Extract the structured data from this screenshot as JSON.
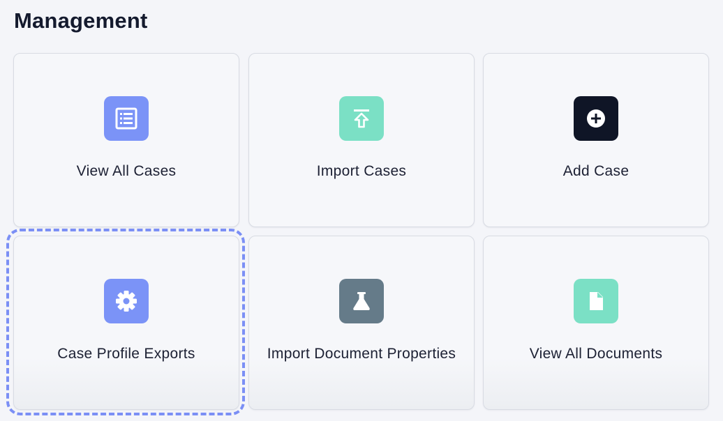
{
  "section": {
    "title": "Management"
  },
  "cards": [
    {
      "label": "View All Cases",
      "icon": "list-icon",
      "tile_color": "#7b93f7",
      "glyph_color": "#ffffff"
    },
    {
      "label": "Import Cases",
      "icon": "upload-icon",
      "tile_color": "#7be0c5",
      "glyph_color": "#ffffff"
    },
    {
      "label": "Add Case",
      "icon": "plus-circle-icon",
      "tile_color": "#0f1526",
      "glyph_color": "#ffffff"
    },
    {
      "label": "Case Profile Exports",
      "icon": "gear-icon",
      "tile_color": "#7b93f7",
      "glyph_color": "#ffffff",
      "focused": true
    },
    {
      "label": "Import Document Properties",
      "icon": "flask-icon",
      "tile_color": "#657b89",
      "glyph_color": "#ffffff"
    },
    {
      "label": "View All Documents",
      "icon": "document-icon",
      "tile_color": "#7be0c5",
      "glyph_color": "#ffffff"
    }
  ],
  "colors": {
    "focus_ring": "#7b8ff5",
    "background": "#f4f5f9",
    "card_border": "#d8dbe3"
  }
}
